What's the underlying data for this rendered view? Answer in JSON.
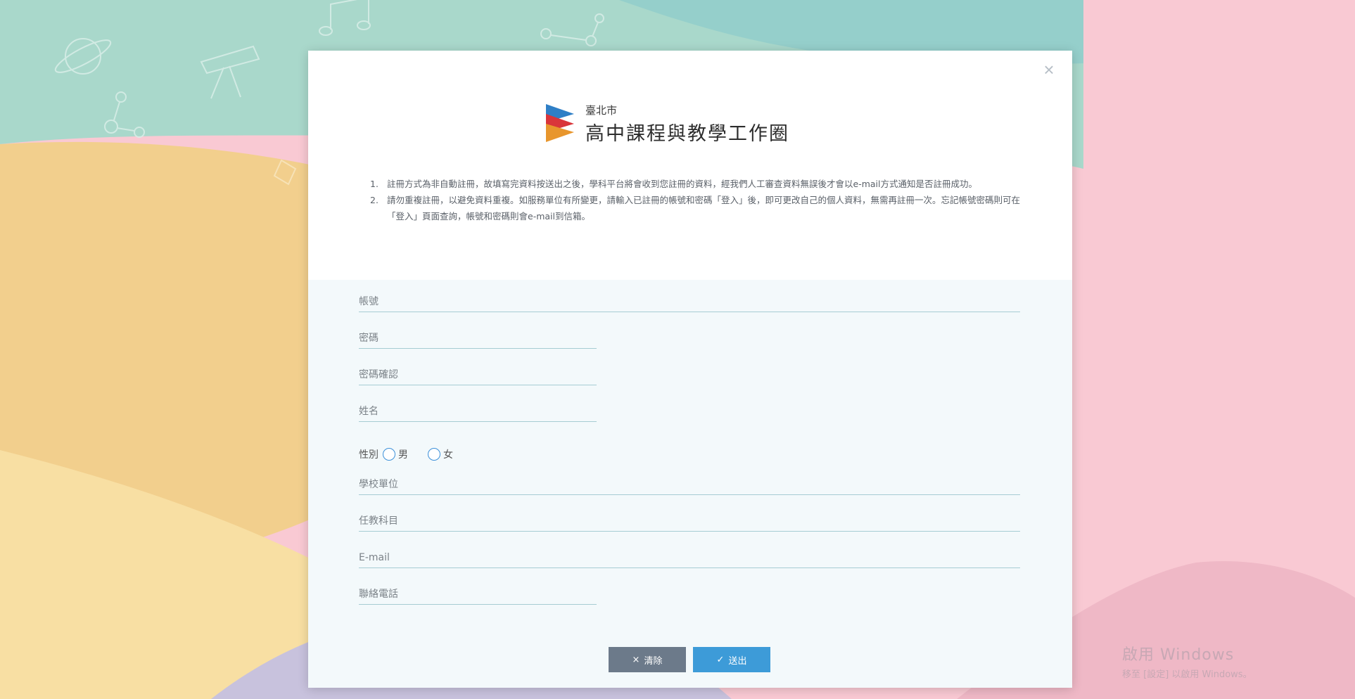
{
  "colors": {
    "accent": "#3d9bd8",
    "clear_button": "#6c7a8a",
    "field_line": "#a6ccd3"
  },
  "brand": {
    "small": "臺北市",
    "large": "高中課程與教學工作圈"
  },
  "notes": [
    {
      "num": "1.",
      "text": "註冊方式為非自動註冊，故填寫完資料按送出之後，學科平台將會收到您註冊的資料，經我們人工審查資料無誤後才會以e-mail方式通知是否註冊成功。"
    },
    {
      "num": "2.",
      "text": "請勿重複註冊，以避免資料重複。如服務單位有所變更，請輸入已註冊的帳號和密碼「登入」後，即可更改自己的個人資料，無需再註冊一次。忘記帳號密碼則可在「登入」頁面查詢，帳號和密碼則會e-mail到信箱。"
    }
  ],
  "form": {
    "account": {
      "placeholder": "帳號",
      "value": ""
    },
    "password": {
      "placeholder": "密碼",
      "value": ""
    },
    "password_confirm": {
      "placeholder": "密碼確認",
      "value": ""
    },
    "name": {
      "placeholder": "姓名",
      "value": ""
    },
    "gender": {
      "label": "性別",
      "options": [
        "男",
        "女"
      ]
    },
    "school": {
      "placeholder": "學校單位",
      "value": ""
    },
    "subject": {
      "placeholder": "任教科目",
      "value": ""
    },
    "email": {
      "placeholder": "E-mail",
      "value": ""
    },
    "phone": {
      "placeholder": "聯絡電話",
      "value": ""
    }
  },
  "buttons": {
    "close": "×",
    "clear": "清除",
    "clear_icon": "×",
    "submit": "送出",
    "submit_icon": "✓"
  },
  "watermark": {
    "line1": "啟用 Windows",
    "line2": "移至 [設定] 以啟用 Windows。"
  }
}
